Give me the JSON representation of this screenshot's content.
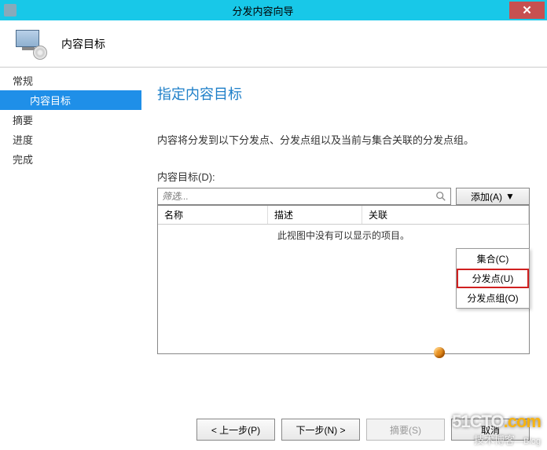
{
  "titlebar": {
    "title": "分发内容向导"
  },
  "header": {
    "title": "内容目标"
  },
  "sidebar": {
    "items": [
      {
        "label": "常规",
        "selected": false,
        "indent": false
      },
      {
        "label": "内容目标",
        "selected": true,
        "indent": true
      },
      {
        "label": "摘要",
        "selected": false,
        "indent": false
      },
      {
        "label": "进度",
        "selected": false,
        "indent": false
      },
      {
        "label": "完成",
        "selected": false,
        "indent": false
      }
    ]
  },
  "main": {
    "title": "指定内容目标",
    "description": "内容将分发到以下分发点、分发点组以及当前与集合关联的分发点组。",
    "field_label": "内容目标(D):",
    "filter_placeholder": "筛选...",
    "add_label": "添加(A)",
    "dropdown": {
      "items": [
        {
          "label": "集合(C)"
        },
        {
          "label": "分发点(U)"
        },
        {
          "label": "分发点组(O)"
        }
      ]
    },
    "columns": {
      "c1": "名称",
      "c2": "描述",
      "c3": "关联"
    },
    "empty": "此视图中没有可以显示的项目。"
  },
  "buttons": {
    "prev": "< 上一步(P)",
    "next": "下一步(N) >",
    "summary": "摘要(S)",
    "cancel": "取消"
  },
  "watermark": {
    "line1a": "51CTO",
    "line1b": ".com",
    "line2a": "技术博客",
    "line2b": "—Blog"
  }
}
